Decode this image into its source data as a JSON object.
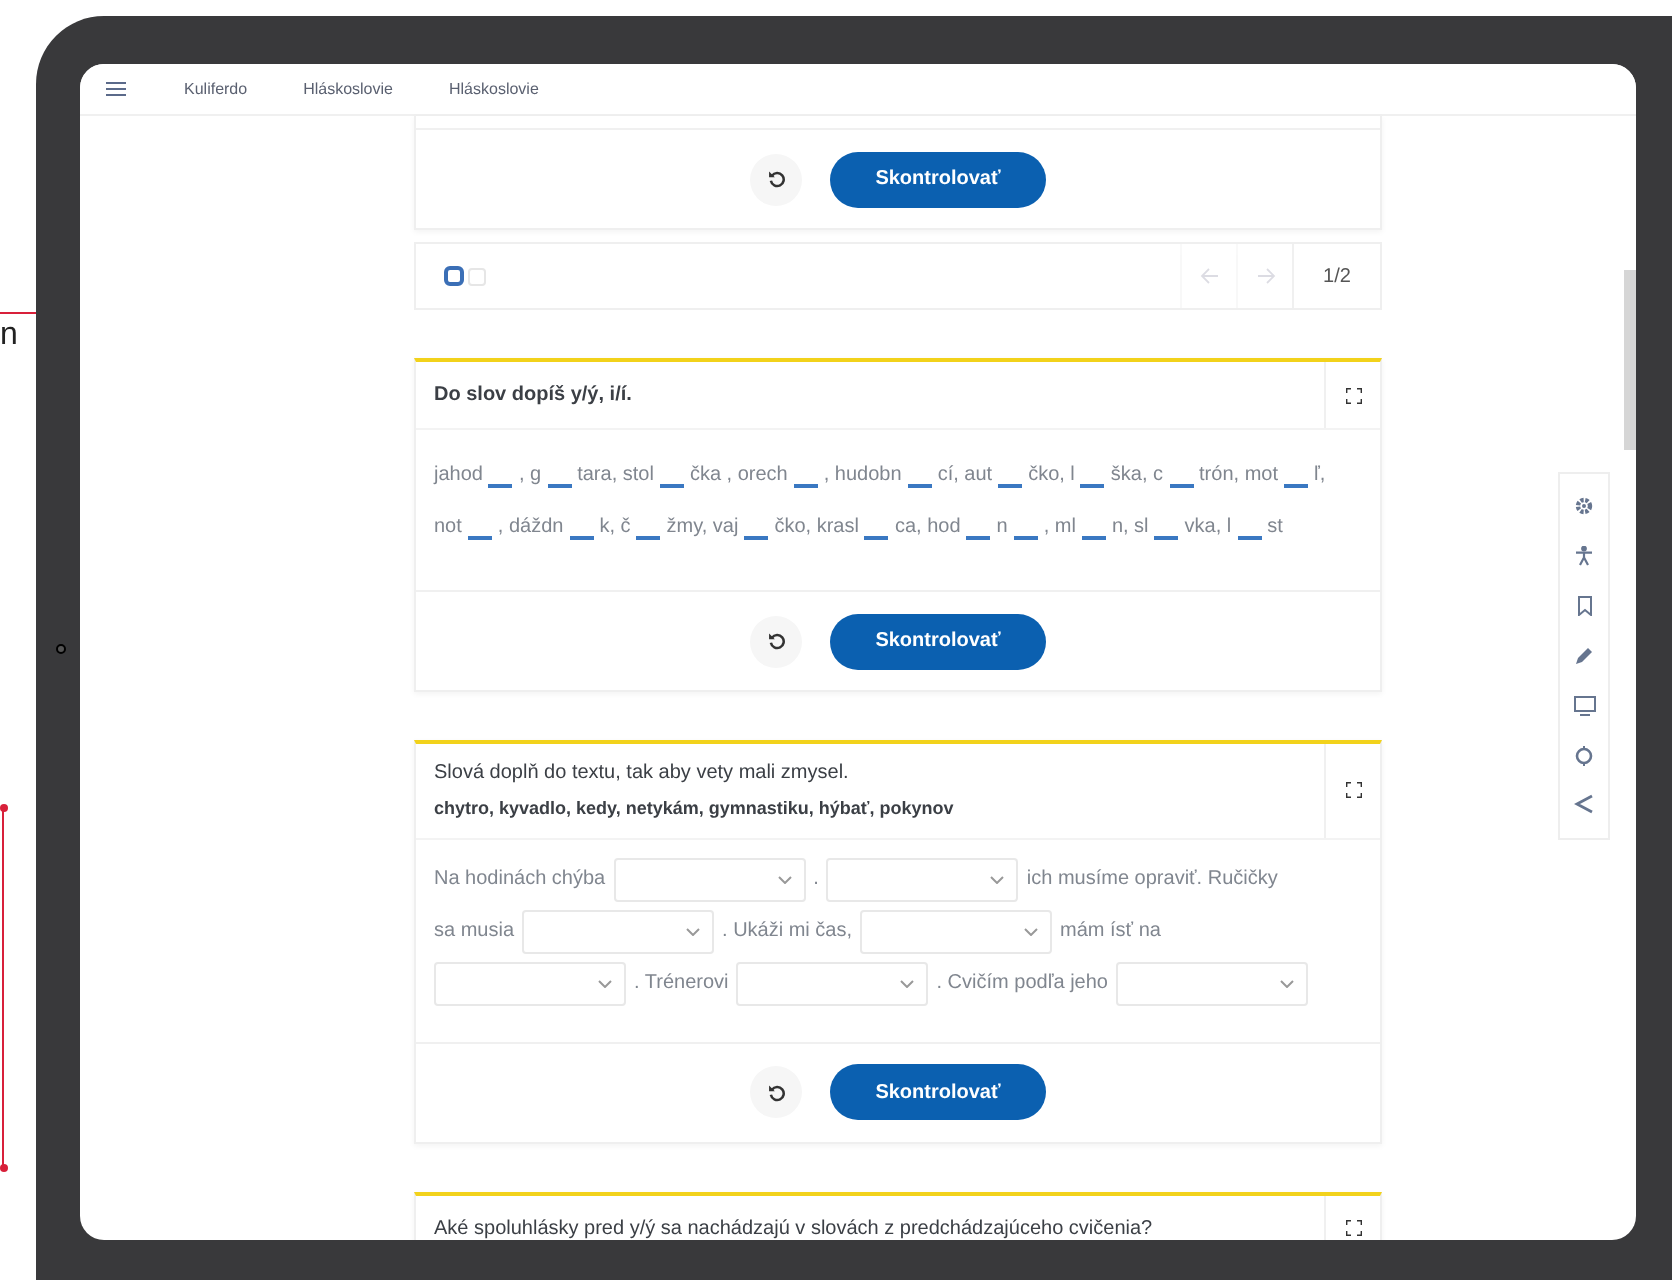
{
  "annotation": {
    "text": "n"
  },
  "nav": {
    "links": [
      "Kuliferdo",
      "Hláskoslovie",
      "Hláskoslovie"
    ]
  },
  "top_card": {
    "check_button": "Skontrolovať"
  },
  "pager": {
    "pages": [
      {
        "selected": true
      },
      {
        "selected": false
      }
    ],
    "prev": {
      "disabled": true
    },
    "next": {
      "disabled": true
    },
    "counter": "1/2"
  },
  "exercises": [
    {
      "kind": "blanks",
      "title": "Do slov dopíš y/ý, i/í.",
      "check_button": "Skontrolovať",
      "lines": [
        [
          "jahod",
          ", g",
          "tara, stol",
          "čka , orech",
          ", hudobn",
          "cí, aut",
          "čko, l",
          "ška, c",
          "trón, mot",
          "ľ,"
        ],
        [
          "not",
          ", dáždn",
          "k, č",
          "žmy, vaj",
          "čko, krasl",
          "ca, hod",
          "n",
          ", ml",
          "n, sl",
          "vka, l",
          "st"
        ]
      ]
    },
    {
      "kind": "dropdowns",
      "title": "Slová doplň do textu, tak aby vety mali zmysel.",
      "word_bank": "chytro, kyvadlo, kedy, netykám, gymnastiku, hýbať, pokynov",
      "check_button": "Skontrolovať",
      "lines": [
        [
          {
            "kind": "text",
            "text": "Na hodinách chýba"
          },
          {
            "kind": "select"
          },
          {
            "kind": "text",
            "text": "."
          },
          {
            "kind": "select"
          },
          {
            "kind": "text",
            "text": "ich musíme opraviť. Ručičky"
          }
        ],
        [
          {
            "kind": "text",
            "text": "sa musia"
          },
          {
            "kind": "select"
          },
          {
            "kind": "text",
            "text": ". Ukáži mi čas,"
          },
          {
            "kind": "select"
          },
          {
            "kind": "text",
            "text": "mám ísť na"
          }
        ],
        [
          {
            "kind": "select"
          },
          {
            "kind": "text",
            "text": ". Trénerovi"
          },
          {
            "kind": "select"
          },
          {
            "kind": "text",
            "text": ". Cvičím podľa jeho"
          },
          {
            "kind": "select"
          }
        ]
      ]
    },
    {
      "kind": "question",
      "title": "Aké spoluhlásky pred y/ý sa nachádzajú v slovách z predchádzajúceho cvičenia?"
    }
  ]
}
